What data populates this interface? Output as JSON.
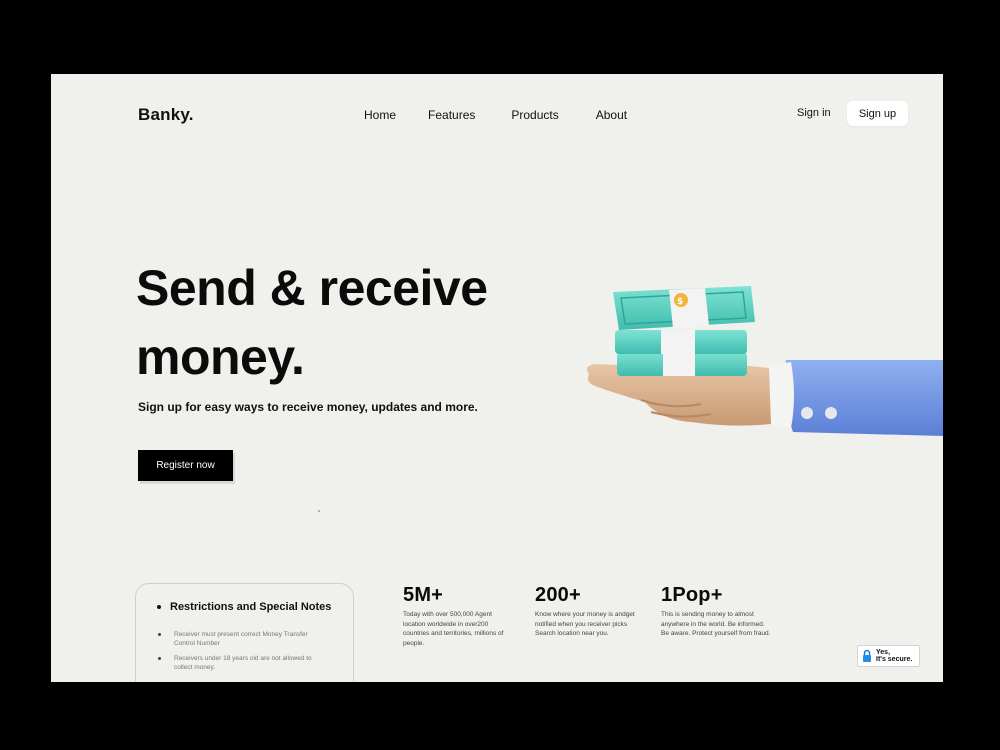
{
  "header": {
    "logo": "Banky.",
    "nav": [
      "Home",
      "Features",
      "Products",
      "About"
    ],
    "signin_label": "Sign in",
    "signup_label": "Sign up"
  },
  "hero": {
    "title_line1": "Send & receive",
    "title_line2": "money.",
    "subtitle": "Sign up for easy ways to receive money, updates and more.",
    "cta_label": "Register now"
  },
  "notes": {
    "title": "Restrictions and Special Notes",
    "items": [
      "Receiver must present correct Money Transfer Control Number",
      "Receivers under 18 years old are not allowed to collect money."
    ]
  },
  "stats": [
    {
      "value": "5M+",
      "desc": "Today with over 500,000 Agent location worldwide in over200 countries and territories, millions of  people."
    },
    {
      "value": "200+",
      "desc": "Know where your money is andget notified when you receiver picks Search location near you."
    },
    {
      "value": "1Pop+",
      "desc": "This is sending money to almost anywhere in the world. Be informed. Be aware. Protect yourself from fraud."
    }
  ],
  "secure_badge": {
    "line1": "Yes,",
    "line2": "It's secure."
  },
  "colors": {
    "page_bg": "#f0f0ed",
    "frame": "#000000",
    "cta_bg": "#000000",
    "cash": "#5fd3c4",
    "sleeve": "#6f93e0"
  }
}
